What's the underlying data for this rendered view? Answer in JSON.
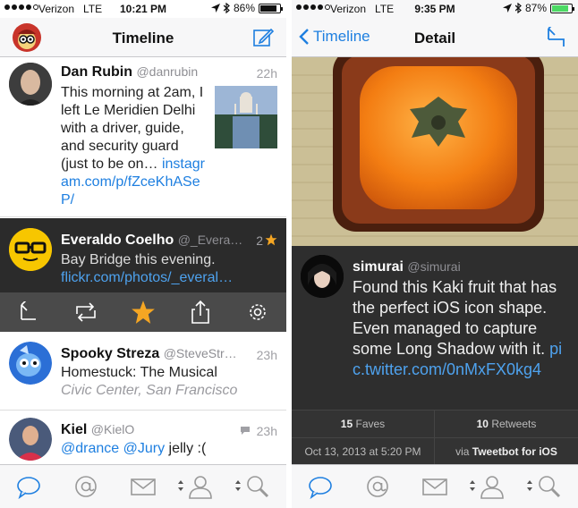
{
  "left": {
    "status": {
      "carrier": "Verizon",
      "network": "LTE",
      "time": "10:21 PM",
      "battery": "86%"
    },
    "nav": {
      "title": "Timeline"
    },
    "tweets": [
      {
        "name": "Dan Rubin",
        "handle": "@danrubin",
        "age": "22h",
        "text": "This morning at 2am, I left Le Meridien Delhi with a driver, guide, and security guard (just to be on…",
        "link": "instagram.com/p/fZceKhASeP/"
      },
      {
        "name": "Everaldo Coelho",
        "handle": "@_Evera…",
        "age": "2",
        "text": "Bay Bridge this evening.",
        "link": "flickr.com/photos/_everal…"
      },
      {
        "name": "Spooky Streza",
        "handle": "@SteveStr…",
        "age": "23h",
        "text": "Homestuck: The Musical",
        "location": "Civic Center, San Francisco"
      },
      {
        "name": "Kiel",
        "handle": "@KielO",
        "age": "23h",
        "mention1": "@drance",
        "mention2": "@Jury",
        "text": "jelly :("
      }
    ]
  },
  "right": {
    "status": {
      "carrier": "Verizon",
      "network": "LTE",
      "time": "9:35 PM",
      "battery": "87%"
    },
    "nav": {
      "back": "Timeline",
      "title": "Detail"
    },
    "tweet": {
      "name": "simurai",
      "handle": "@simurai",
      "text": "Found this Kaki fruit that has the perfect iOS icon shape. Even managed to capture some Long Shadow with it.",
      "link": "pic.twitter.com/0nMxFX0kg4"
    },
    "stats": {
      "faves_count": "15",
      "faves_label": "Faves",
      "retweets_count": "10",
      "retweets_label": "Retweets",
      "date": "Oct 13, 2013 at 5:20 PM",
      "via_label": "via",
      "via_app": "Tweetbot for iOS"
    }
  },
  "colors": {
    "accent": "#1e7fe0",
    "selected_bg": "#2b2b2b",
    "action_bg": "#4a4a4a",
    "star": "#f5a623"
  }
}
